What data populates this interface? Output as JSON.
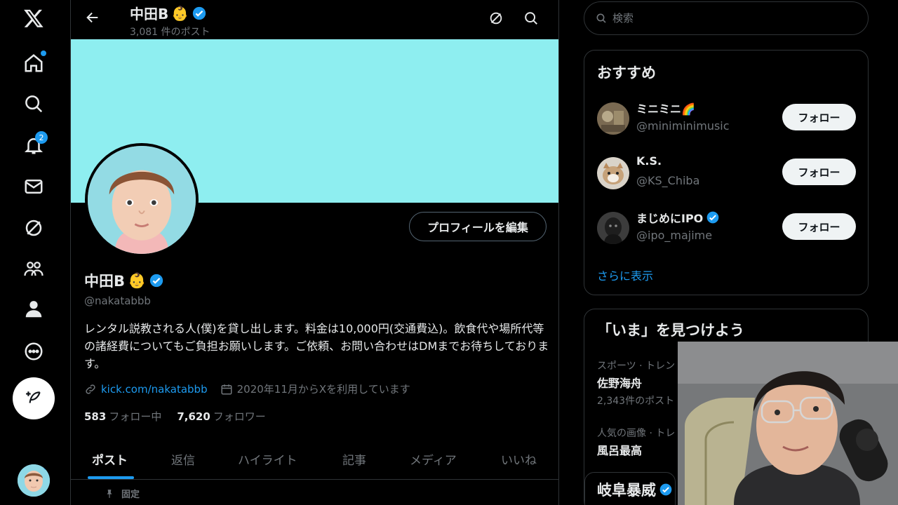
{
  "nav": {
    "notification_count": "2"
  },
  "header": {
    "name": "中田B",
    "post_count": "3,081 件のポスト"
  },
  "profile": {
    "edit_button": "プロフィールを編集",
    "name": "中田B",
    "handle": "@nakatabbb",
    "bio": "レンタル説教される人(僕)を貸し出します。料金は10,000円(交通費込)。飲食代や場所代等の諸経費についてもご負担お願いします。ご依頼、お問い合わせはDMまでお待ちしております。",
    "link": "kick.com/nakatabbb",
    "joined": "2020年11月からXを利用しています",
    "following_count": "583",
    "following_label": "フォロー中",
    "followers_count": "7,620",
    "followers_label": "フォロワー"
  },
  "tabs": [
    "ポスト",
    "返信",
    "ハイライト",
    "記事",
    "メディア",
    "いいね"
  ],
  "pinned_label": "固定",
  "search": {
    "placeholder": "検索"
  },
  "recommend": {
    "title": "おすすめ",
    "users": [
      {
        "name": "ミニミニ🌈",
        "handle": "@miniminimusic",
        "button": "フォロー"
      },
      {
        "name": "K.S.",
        "handle": "@KS_Chiba",
        "button": "フォロー"
      },
      {
        "name": "まじめにIPO",
        "handle": "@ipo_majime",
        "button": "フォロー"
      }
    ],
    "show_more": "さらに表示"
  },
  "trends": {
    "title": "「いま」を見つけよう",
    "items": [
      {
        "category": "スポーツ · トレン",
        "name": "佐野海舟",
        "count": "2,343件のポスト"
      },
      {
        "category": "人気の画像 · トレ",
        "name": "風呂最高"
      }
    ],
    "partial_user": "岐阜暴威"
  },
  "colors": {
    "accent": "#1d9bf0",
    "banner": "#8eeef0",
    "background": "#000000"
  }
}
